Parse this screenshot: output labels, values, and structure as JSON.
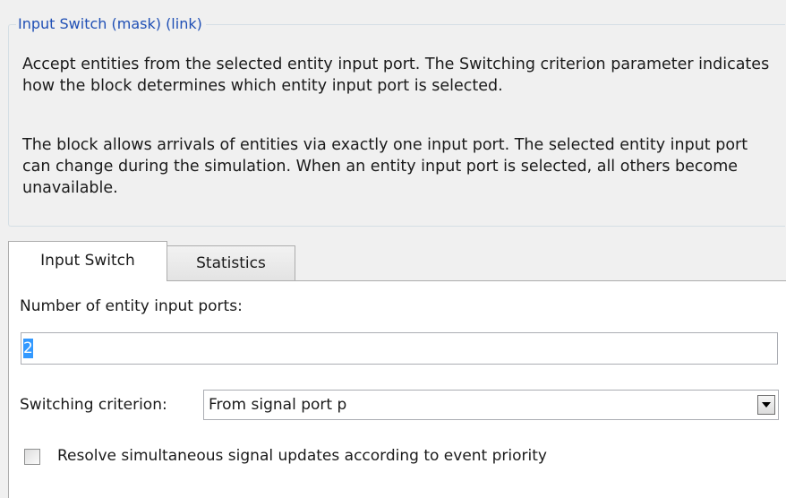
{
  "groupbox": {
    "legend": "Input Switch  (mask) (link)",
    "description_para1": "Accept entities from the selected entity input port. The Switching criterion parameter indicates how the block determines which entity input port is selected.",
    "description_para2": "The block allows arrivals of entities via exactly one input port. The selected entity input port can change during the simulation. When an entity input port is selected, all others become unavailable."
  },
  "tabs": [
    {
      "label": "Input Switch",
      "active": true
    },
    {
      "label": "Statistics",
      "active": false
    }
  ],
  "panel": {
    "ports_label": "Number of entity input ports:",
    "ports_value": "2",
    "criterion_label": "Switching criterion:",
    "criterion_value": "From signal port p",
    "criterion_icon": "chevron-down-icon",
    "resolve_checkbox_label": "Resolve simultaneous signal updates according to event priority",
    "resolve_checked": false
  },
  "colors": {
    "legend_text": "#1f4fb5",
    "selection": "#3399ff",
    "background": "#f0f0f0"
  }
}
